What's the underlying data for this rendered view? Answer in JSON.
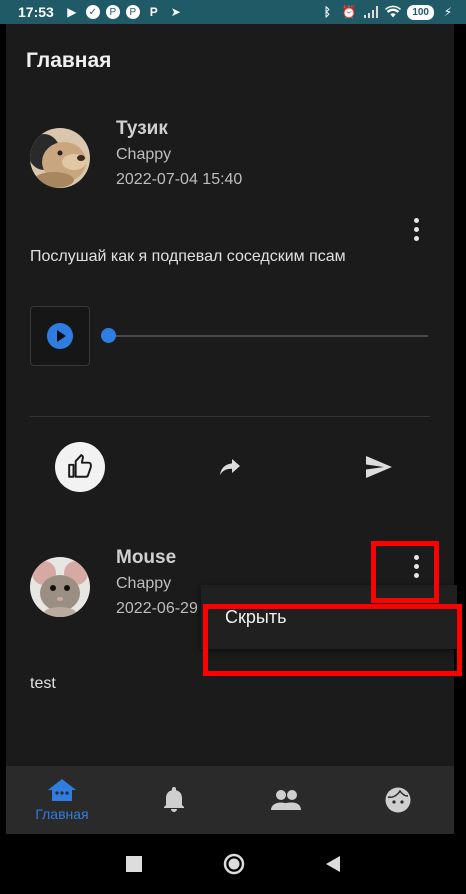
{
  "status_bar": {
    "time": "17:53",
    "battery": "100"
  },
  "header": {
    "title": "Главная"
  },
  "posts": [
    {
      "author": "Тузик",
      "group": "Chappy",
      "date": "2022-07-04 15:40",
      "text": "Послушай как я подпевал соседским псам",
      "audio_progress": 0
    },
    {
      "author": "Mouse",
      "group": "Chappy",
      "date": "2022-06-29 12:10",
      "text": "test"
    }
  ],
  "context_menu": {
    "hide_label": "Скрыть"
  },
  "bottom_nav": {
    "items": [
      {
        "icon": "home-icon",
        "label": "Главная",
        "active": true
      },
      {
        "icon": "bell-icon",
        "label": "",
        "active": false
      },
      {
        "icon": "people-icon",
        "label": "",
        "active": false
      },
      {
        "icon": "face-icon",
        "label": "",
        "active": false
      }
    ]
  },
  "colors": {
    "accent": "#2f7de1",
    "background": "#1b1b1b",
    "status_bar": "#1f5a66",
    "highlight": "#ff0000"
  }
}
